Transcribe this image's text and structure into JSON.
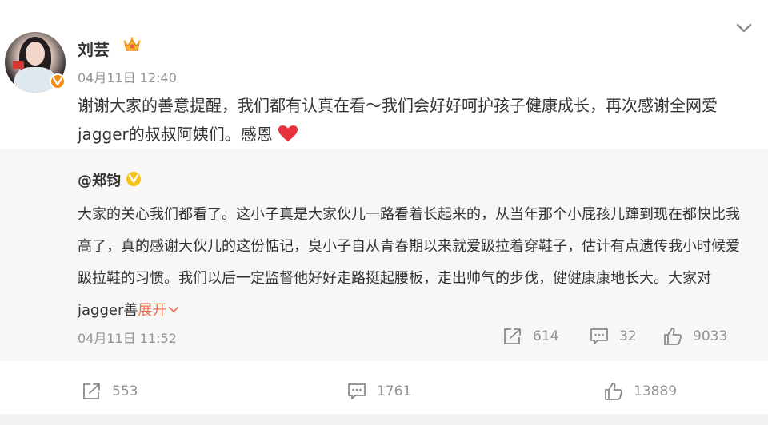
{
  "post": {
    "username": "刘芸",
    "timestamp": "04月11日 12:40",
    "content": "谢谢大家的善意提醒，我们都有认真在看～我们会好好呵护孩子健康成长，再次感谢全网爱jagger的叔叔阿姨们。感恩",
    "actions": {
      "repost_count": "553",
      "comment_count": "1761",
      "like_count": "13889"
    }
  },
  "repost": {
    "author": "@郑钧",
    "text": "大家的关心我们都看了。这小子真是大家伙儿一路看着长起来的，从当年那个小屁孩儿蹿到现在都快比我高了，真的感谢大伙儿的这份惦记，臭小子自从青春期以来就爱趿拉着穿鞋子，估计有点遗传我小时候爱趿拉鞋的习惯。我们以后一定监督他好好走路挺起腰板，走出帅气的步伐，健健康康地长大。大家对jagger善",
    "expand_label": "展开",
    "timestamp": "04月11日 11:52",
    "actions": {
      "repost_count": "614",
      "comment_count": "32",
      "like_count": "9033"
    }
  },
  "colors": {
    "accent_link": "#eb7350",
    "meta_gray": "#939393",
    "repost_bg": "#f7f7f7",
    "heart": "#e8323c",
    "verified_orange": "#f08c12",
    "verified_gold": "#f7c21a"
  },
  "icons": {
    "collapse": "chevron-down-icon",
    "member": "crown-icon",
    "verified": "verified-v-icon",
    "heart": "heart-emoji",
    "repost": "repost-icon",
    "comment": "comment-icon",
    "like": "thumbs-up-icon",
    "expand": "chevron-down-icon"
  }
}
